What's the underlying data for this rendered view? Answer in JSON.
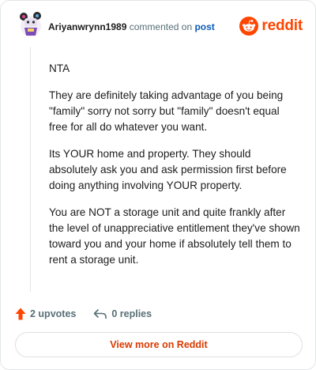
{
  "header": {
    "author": "Ariyanwrynn1989",
    "action": "commented on",
    "target": "post",
    "brand": "reddit",
    "icons": {
      "avatar": "snoo-avatar",
      "logo": "reddit-snoo-icon"
    }
  },
  "comment": {
    "paragraphs": [
      "NTA",
      "They are definitely taking advantage of you being \"family\" sorry not sorry but \"family\" doesn't equal free for all do whatever you want.",
      "Its YOUR home and property. They should absolutely ask you and ask permission first before doing anything involving YOUR property.",
      "You are NOT a storage unit and quite frankly after the level of unappreciative entitlement they've shown toward you and your home if absolutely tell them to rent a storage unit."
    ]
  },
  "stats": {
    "upvotes": "2 upvotes",
    "replies": "0 replies"
  },
  "footer": {
    "view_more": "View more on Reddit"
  },
  "colors": {
    "brand": "#ff4500",
    "upvote": "#ff4500",
    "button_text": "#d93a00",
    "link": "#0a5bb8",
    "muted": "#576f76"
  }
}
